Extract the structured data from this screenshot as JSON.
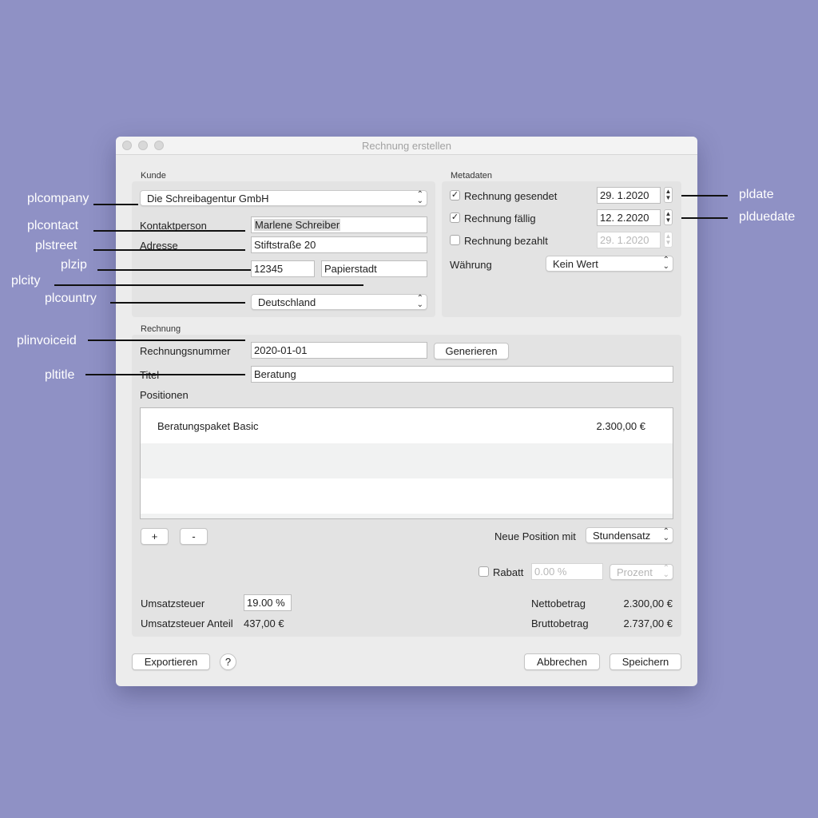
{
  "window": {
    "title": "Rechnung erstellen"
  },
  "annotations": [
    "plcompany",
    "plcontact",
    "plstreet",
    "plzip",
    "plcity",
    "plcountry",
    "plinvoiceid",
    "pltitle",
    "pldate",
    "plduedate"
  ],
  "kunde": {
    "section_label": "Kunde",
    "company": "Die Schreibagentur GmbH",
    "contact_label": "Kontaktperson",
    "contact_value": "Marlene Schreiber",
    "address_label": "Adresse",
    "street_value": "Stiftstraße 20",
    "zip_value": "12345",
    "city_value": "Papierstadt",
    "country": "Deutschland"
  },
  "metadaten": {
    "section_label": "Metadaten",
    "sent_label": "Rechnung gesendet",
    "sent_checked": true,
    "sent_date": "29.  1.2020",
    "due_label": "Rechnung fällig",
    "due_checked": true,
    "due_date": "12.  2.2020",
    "paid_label": "Rechnung bezahlt",
    "paid_checked": false,
    "paid_date": "29.  1.2020",
    "currency_label": "Währung",
    "currency_value": "Kein Wert"
  },
  "rechnung": {
    "section_label": "Rechnung",
    "number_label": "Rechnungsnummer",
    "number_value": "2020-01-01",
    "generate_button": "Generieren",
    "title_label": "Titel",
    "title_value": "Beratung",
    "positions_label": "Positionen",
    "positions": [
      {
        "name": "Beratungspaket Basic",
        "price": "2.300,00 €"
      },
      {
        "name": "",
        "price": ""
      },
      {
        "name": "",
        "price": ""
      }
    ],
    "add_button": "+",
    "remove_button": "-",
    "new_position_label": "Neue Position mit",
    "new_position_value": "Stundensatz",
    "discount_label": "Rabatt",
    "discount_checked": false,
    "discount_value": "0.00 %",
    "discount_type": "Prozent",
    "tax_label": "Umsatzsteuer",
    "tax_value": "19.00 %",
    "tax_share_label": "Umsatzsteuer Anteil",
    "tax_share_value": "437,00 €",
    "net_label": "Nettobetrag",
    "net_value": "2.300,00 €",
    "gross_label": "Bruttobetrag",
    "gross_value": "2.737,00 €"
  },
  "footer": {
    "export_button": "Exportieren",
    "help_button": "?",
    "cancel_button": "Abbrechen",
    "save_button": "Speichern"
  },
  "icons": {
    "check": "✓",
    "chevron_updown": "⌃⌄",
    "stepper": "▲▼"
  },
  "colors": {
    "background": "#8f91c5",
    "window": "#ececec",
    "panel": "#e3e3e3"
  }
}
